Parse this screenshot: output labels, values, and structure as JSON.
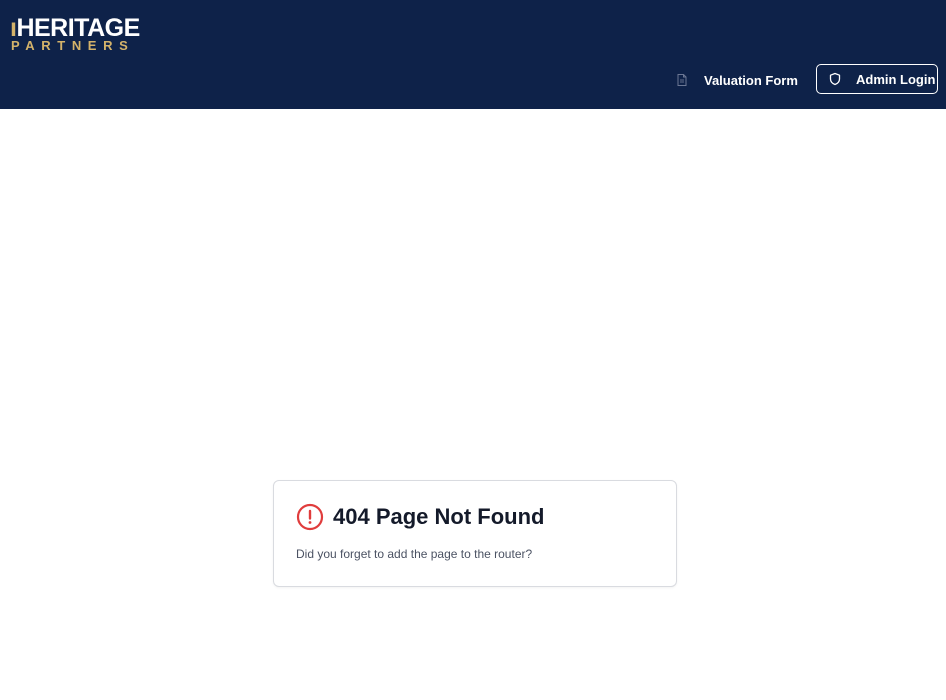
{
  "header": {
    "logo": {
      "line1_mark": "ı",
      "line1_text": "HERITAGE",
      "line2_text": "PARTNERS"
    },
    "nav": {
      "valuation_form": {
        "label": "Valuation Form",
        "icon": "document-icon"
      },
      "admin_login": {
        "label": "Admin Login",
        "icon": "shield-icon"
      }
    }
  },
  "error_card": {
    "icon": "alert-circle-icon",
    "title": "404 Page Not Found",
    "message": "Did you forget to add the page to the router?"
  },
  "colors": {
    "header_bg": "#0e2249",
    "logo_gold": "#d4b36a",
    "alert_red": "#e03c3c",
    "title_text": "#141a2a"
  }
}
